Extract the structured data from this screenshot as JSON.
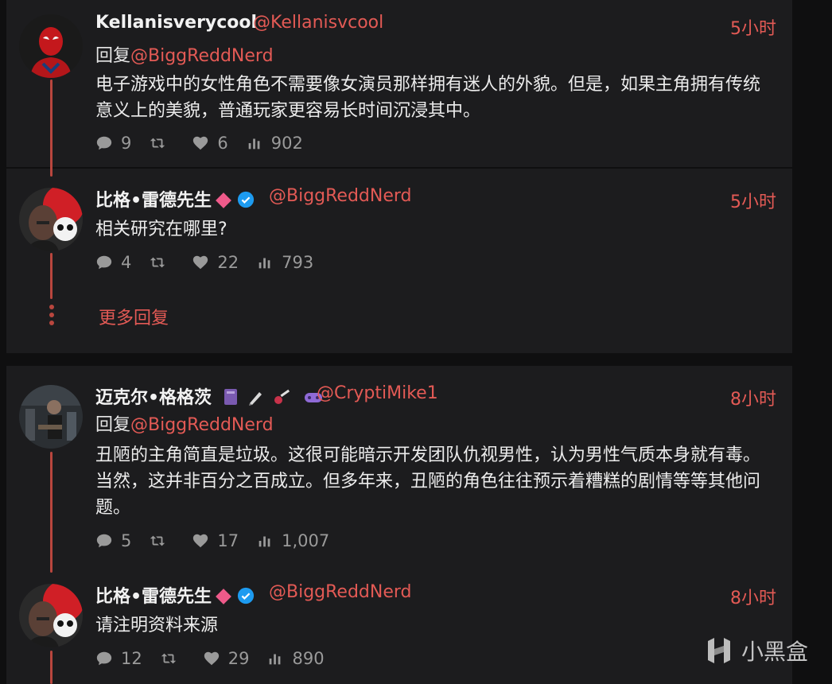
{
  "tweets": [
    {
      "name": "Kellanisverycool",
      "handle": "@Kellanisvcool",
      "time": "5小时",
      "reply_prefix": "回复",
      "reply_handle": "@BiggReddNerd",
      "text": "电子游戏中的女性角色不需要像女演员那样拥有迷人的外貌。但是，如果主角拥有传统意义上的美貌，普通玩家更容易长时间沉浸其中。",
      "stats": {
        "replies": "9",
        "likes": "6",
        "views": "902"
      }
    },
    {
      "name": "比格•雷德先生",
      "handle": "@BiggReddNerd",
      "time": "5小时",
      "text": "相关研究在哪里?",
      "stats": {
        "replies": "4",
        "likes": "22",
        "views": "793"
      }
    },
    {
      "name": "迈克尔•格格茨",
      "handle": "@CryptiMike1",
      "time": "8小时",
      "reply_prefix": "回复",
      "reply_handle": "@BiggReddNerd",
      "text": "丑陋的主角简直是垃圾。这很可能暗示开发团队仇视男性，认为男性气质本身就有毒。当然，这并非百分之百成立。但多年来，丑陋的角色往往预示着糟糕的剧情等等其他问题。",
      "stats": {
        "replies": "5",
        "likes": "17",
        "views": "1,007"
      }
    },
    {
      "name": "比格•雷德先生",
      "handle": "@BiggReddNerd",
      "time": "8小时",
      "text": "请注明资料来源",
      "stats": {
        "replies": "12",
        "likes": "29",
        "views": "890"
      }
    }
  ],
  "more_replies": "更多回复",
  "watermark": "小黑盒",
  "colors": {
    "accent": "#e35a55",
    "thread_line": "#b9463e",
    "card_bg": "#1c1c1e",
    "page_bg": "#0f0f10"
  }
}
